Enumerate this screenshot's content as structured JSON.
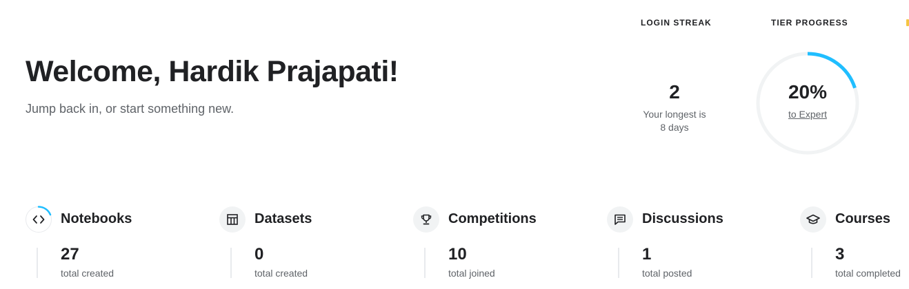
{
  "welcome": {
    "title": "Welcome, Hardik Prajapati!",
    "subtitle": "Jump back in, or start something new."
  },
  "login_streak": {
    "label": "LOGIN STREAK",
    "value": "2",
    "note_line1": "Your longest is",
    "note_line2": "8 days"
  },
  "tier_progress": {
    "label": "TIER PROGRESS",
    "percent_text": "20%",
    "progress_fraction": 0.2,
    "target": "to Expert",
    "ring_color": "#20beff",
    "track_color": "#f1f3f4"
  },
  "activities": [
    {
      "title": "Notebooks",
      "icon": "code-icon",
      "count": "27",
      "caption": "total created"
    },
    {
      "title": "Datasets",
      "icon": "table-icon",
      "count": "0",
      "caption": "total created"
    },
    {
      "title": "Competitions",
      "icon": "trophy-icon",
      "count": "10",
      "caption": "total joined"
    },
    {
      "title": "Discussions",
      "icon": "comment-icon",
      "count": "1",
      "caption": "total posted"
    },
    {
      "title": "Courses",
      "icon": "graduation-cap-icon",
      "count": "3",
      "caption": "total completed"
    }
  ]
}
